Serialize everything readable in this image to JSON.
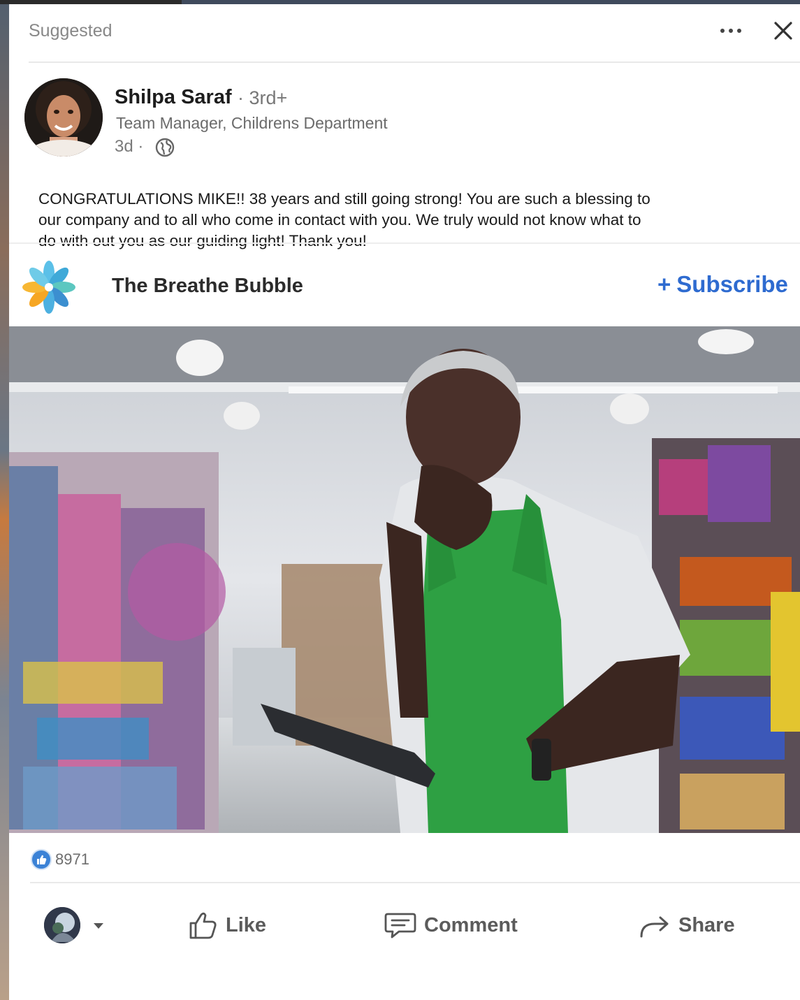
{
  "header": {
    "suggested_label": "Suggested"
  },
  "author": {
    "name": "Shilpa Saraf",
    "degree": "· 3rd+",
    "title": "Team Manager, Childrens Department",
    "age": "3d ·"
  },
  "post": {
    "text": "CONGRATULATIONS MIKE!! 38 years and still going strong! You are such a blessing to our company and to all who come in contact with you. We truly would not know what to do with out you as our guiding light! Thank you!"
  },
  "publication": {
    "name": "The Breathe Bubble",
    "subscribe_label": "Subscribe"
  },
  "social": {
    "reaction_count": "8971"
  },
  "actions": {
    "like": "Like",
    "comment": "Comment",
    "share": "Share"
  },
  "colors": {
    "accent": "#2e6bd0",
    "reaction_blue": "#3b82d6",
    "apron_green": "#2ea043"
  },
  "icons": {
    "more": "more-icon",
    "close": "close-icon",
    "globe": "globe-icon",
    "like": "thumbs-up-icon",
    "comment": "comment-icon",
    "share": "share-arrow-icon",
    "dropdown": "caret-down-icon"
  }
}
